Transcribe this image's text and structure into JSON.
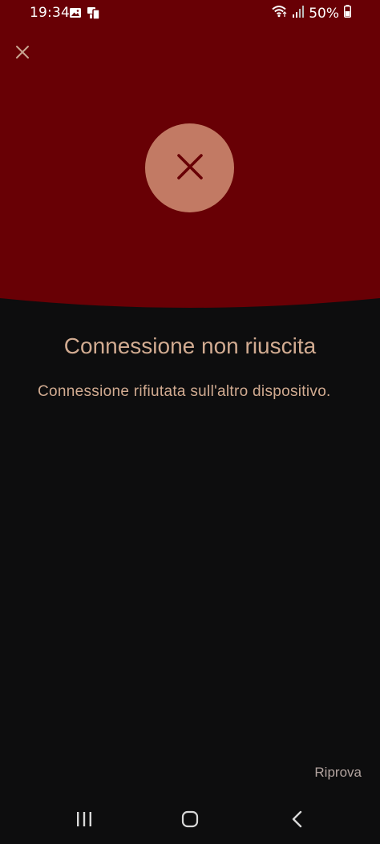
{
  "status_bar": {
    "time": "19:34",
    "battery": "50%"
  },
  "icons": {
    "close": "close-icon",
    "error": "error-x-icon",
    "recents": "recent-apps-icon",
    "home": "home-icon",
    "back": "back-icon"
  },
  "dialog": {
    "title": "Connessione non riuscita",
    "message": "Connessione rifiutata sull'altro dispositivo.",
    "retry_label": "Riprova"
  },
  "colors": {
    "header_bg": "#680005",
    "circle_bg": "#c27a64",
    "x_mark": "#680005",
    "text_accent": "#d1ab91",
    "body_bg": "#0d0d0e"
  }
}
